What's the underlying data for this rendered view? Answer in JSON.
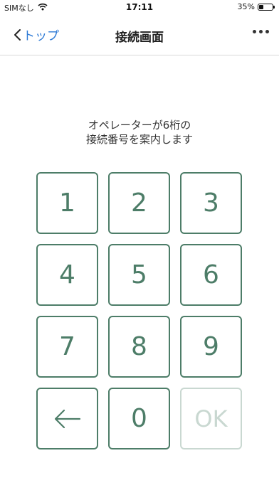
{
  "status": {
    "carrier": "SIMなし",
    "time": "17:11",
    "battery": "35%",
    "battery_level": 0.35
  },
  "nav": {
    "back_label": "トップ",
    "title": "接続画面"
  },
  "instruction": {
    "line1": "オペレーターが6桁の",
    "line2": "接続番号を案内します"
  },
  "keypad": {
    "keys": [
      "1",
      "2",
      "3",
      "4",
      "5",
      "6",
      "7",
      "8",
      "9"
    ],
    "zero": "0",
    "ok": "OK"
  },
  "colors": {
    "accent": "#4d7d68",
    "disabled": "#c9d8d1",
    "link": "#2f7bd6"
  }
}
